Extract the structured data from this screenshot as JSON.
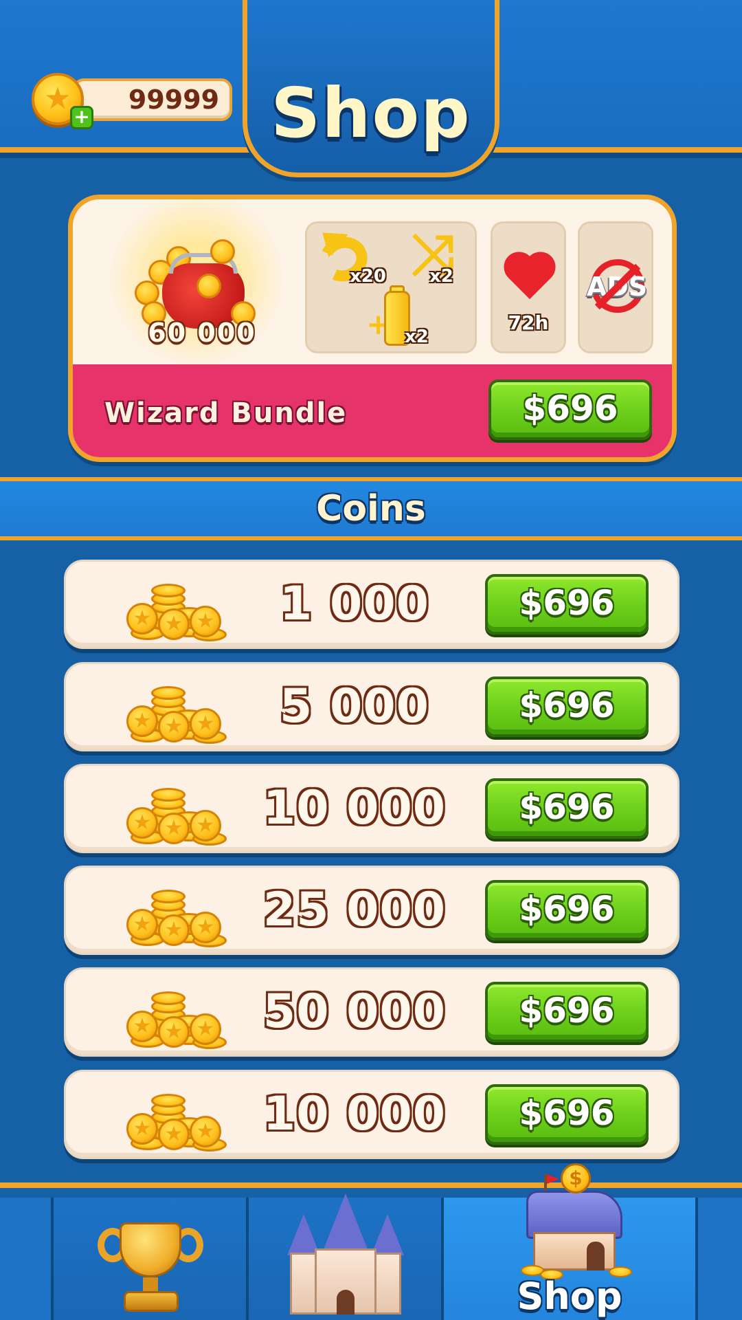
{
  "header": {
    "title": "Shop",
    "coin_balance": "99999",
    "add_coins_symbol": "+"
  },
  "bundle": {
    "name": "Wizard Bundle",
    "coin_amount": "60 000",
    "boosters": [
      {
        "icon": "undo-icon",
        "multiplier": "x20"
      },
      {
        "icon": "shuffle-icon",
        "multiplier": "x2"
      },
      {
        "icon": "bottle-icon",
        "multiplier": "x2"
      }
    ],
    "lives_duration": "72h",
    "no_ads_label": "ADS",
    "price": "$696"
  },
  "coins_section": {
    "title": "Coins",
    "packs": [
      {
        "amount": "1 000",
        "price": "$696"
      },
      {
        "amount": "5 000",
        "price": "$696"
      },
      {
        "amount": "10 000",
        "price": "$696"
      },
      {
        "amount": "25 000",
        "price": "$696"
      },
      {
        "amount": "50 000",
        "price": "$696"
      },
      {
        "amount": "10 000",
        "price": "$696"
      }
    ]
  },
  "bottom_nav": {
    "tabs": [
      {
        "icon": "trophy-icon",
        "label": "",
        "active": false
      },
      {
        "icon": "castle-icon",
        "label": "",
        "active": false
      },
      {
        "icon": "shop-house-icon",
        "label": "Shop",
        "active": true
      }
    ]
  },
  "colors": {
    "background": "#1660a6",
    "accent_gold": "#f0a52a",
    "buy_button_green": "#6ed11c",
    "bundle_pink": "#e6336a",
    "card_cream": "#fdf1e5"
  }
}
